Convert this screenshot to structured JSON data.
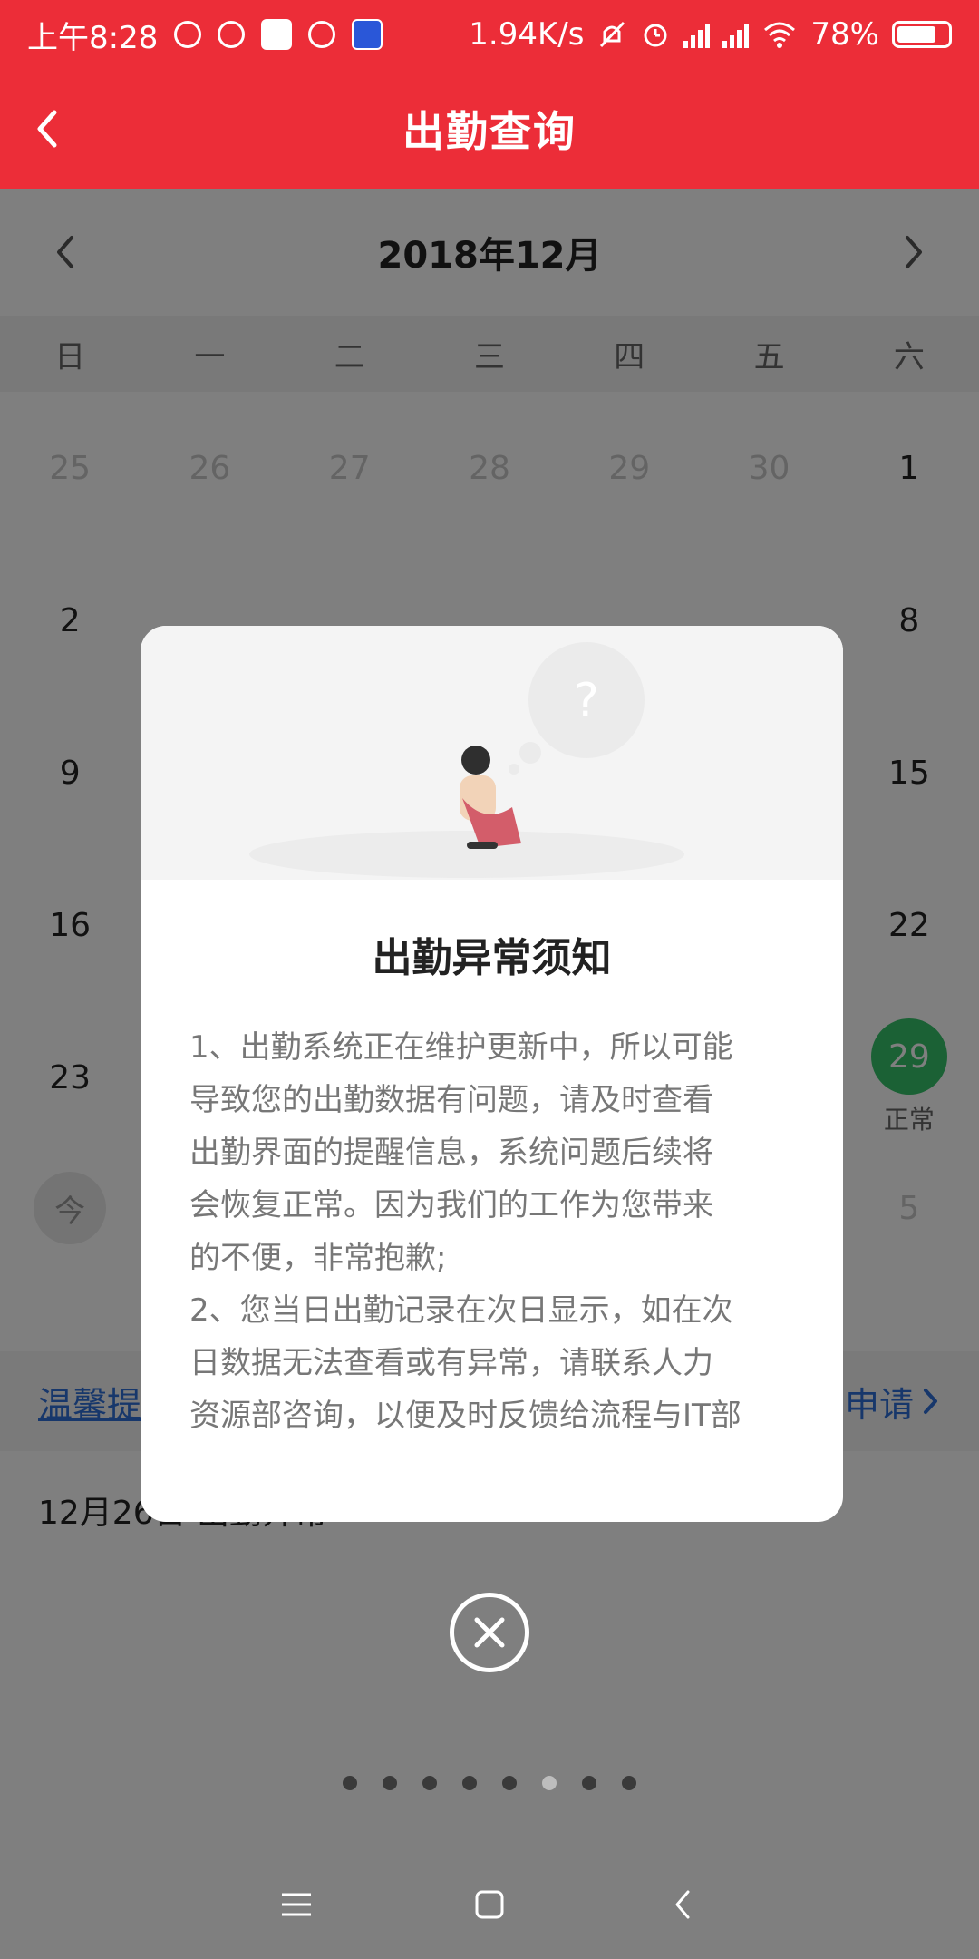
{
  "status_bar": {
    "time": "上午8:28",
    "net_speed": "1.94K/s",
    "battery": "78%"
  },
  "title_bar": {
    "title": "出勤查询",
    "back_icon": "chevron-left-icon"
  },
  "month_nav": {
    "label": "2018年12月",
    "prev_icon": "chevron-left-icon",
    "next_icon": "chevron-right-icon"
  },
  "weekdays": [
    "日",
    "一",
    "二",
    "三",
    "四",
    "五",
    "六"
  ],
  "calendar": {
    "row1": [
      "25",
      "26",
      "27",
      "28",
      "29",
      "30",
      "1"
    ],
    "row2_first": "2",
    "row2_last": "8",
    "row3_first": "9",
    "row3_last": "15",
    "row4_first": "16",
    "row4_last": "22",
    "row5_first": "23",
    "row5_last": "29",
    "row5_last_status": "正常",
    "row6_first": "今",
    "row6_last": "5"
  },
  "tips_row": {
    "left_text": "温馨提",
    "right_text": "申请"
  },
  "list_row": {
    "text": "12月26日 出勤异常"
  },
  "modal": {
    "heading": "出勤异常须知",
    "lines": [
      "1、出勤系统正在维护更新中，所以可能",
      "导致您的出勤数据有问题，请及时查看",
      "出勤界面的提醒信息，系统问题后续将",
      "会恢复正常。因为我们的工作为您带来",
      "的不便，非常抱歉;",
      "2、您当日出勤记录在次日显示，如在次",
      "日数据无法查看或有异常，请联系人力",
      "资源部咨询，以便及时反馈给流程与IT部"
    ]
  },
  "close_icon": "close-circle-icon",
  "pager": {
    "count": 8,
    "active_index": 5
  },
  "colors": {
    "brand_red": "#ec2d38",
    "link_blue": "#2f6fd6",
    "normal_green": "#36c26b"
  }
}
